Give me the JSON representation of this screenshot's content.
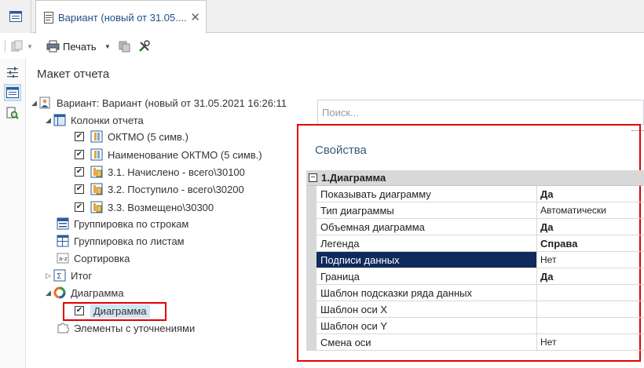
{
  "tabs": {
    "doc_title": "Вариант (новый от 31.05....",
    "close_glyph": "✕"
  },
  "toolbar": {
    "print_label": "Печать"
  },
  "left_panel": {
    "title": "Макет отчета"
  },
  "tree": {
    "root": "Вариант: Вариант (новый от 31.05.2021 16:26:11",
    "columns": "Колонки отчета",
    "col1": "ОКТМО (5 симв.)",
    "col2": "Наименование ОКТМО (5 симв.)",
    "col3": "3.1. Начислено - всего\\30100",
    "col4": "3.2. Поступило - всего\\30200",
    "col5": "3.3. Возмещено\\30300",
    "group_rows": "Группировка по строкам",
    "group_sheets": "Группировка по листам",
    "sort": "Сортировка",
    "total": "Итог",
    "chart": "Диаграмма",
    "chart_child": "Диаграмма",
    "refinements": "Элементы с уточнениями"
  },
  "search": {
    "placeholder": "Поиск..."
  },
  "properties": {
    "title": "Свойства",
    "group_label": "1.Диаграмма",
    "rows": [
      {
        "name": "Показывать диаграмму",
        "value": "Да"
      },
      {
        "name": "Тип диаграммы",
        "value": "Автоматически"
      },
      {
        "name": "Объемная диаграмма",
        "value": "Да"
      },
      {
        "name": "Легенда",
        "value": "Справа"
      },
      {
        "name": "Подписи данных",
        "value": "Нет"
      },
      {
        "name": "Граница",
        "value": "Да"
      },
      {
        "name": "Шаблон подсказки ряда данных",
        "value": ""
      },
      {
        "name": "Шаблон оси X",
        "value": ""
      },
      {
        "name": "Шаблон оси Y",
        "value": ""
      },
      {
        "name": "Смена оси",
        "value": "Нет"
      }
    ]
  },
  "colors": {
    "accent": "#1f4e8c",
    "selection": "#0f2a5c",
    "highlight_red": "#e00000"
  }
}
